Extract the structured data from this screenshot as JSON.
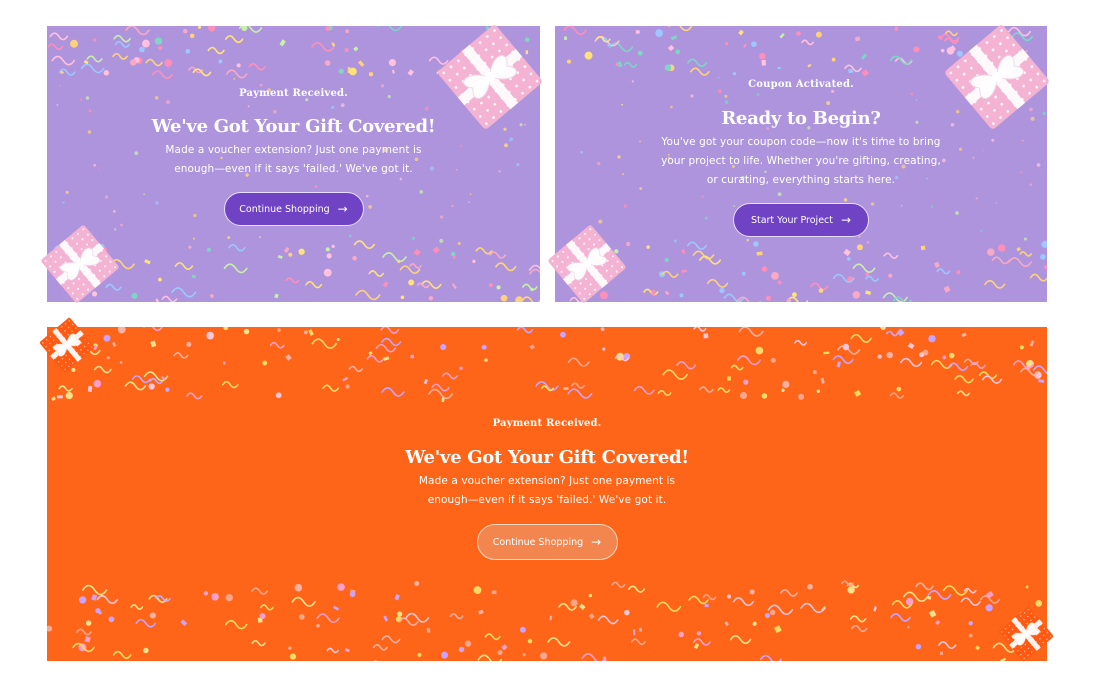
{
  "colors": {
    "purple_bg": "#ad94dd",
    "purple_button": "#7043c4",
    "orange_bg": "#fe6519",
    "orange_button": "#f2864e",
    "gift_pink": "#f4b3d3",
    "gift_orange": "#ff5a14"
  },
  "cards": [
    {
      "eyebrow": "Payment Received.",
      "title": "We've Got Your Gift Covered!",
      "body_lines": [
        "Made a voucher extension? Just one payment is",
        "enough—even if it says 'failed.' We've got it."
      ],
      "button_label": "Continue Shopping",
      "button_icon": "arrow-right-icon"
    },
    {
      "eyebrow": "Coupon Activated.",
      "title": "Ready to Begin?",
      "body_lines": [
        "You've got your coupon code—now it's time to bring",
        "your project to life. Whether you're gifting, creating,",
        "or curating, everything starts here."
      ],
      "button_label": "Start Your Project",
      "button_icon": "arrow-right-icon"
    },
    {
      "eyebrow": "Payment Received.",
      "title": "We've Got Your Gift Covered!",
      "body_lines": [
        "Made a voucher extension? Just one payment is",
        "enough—even if it says 'failed.' We've got it."
      ],
      "button_label": "Continue Shopping",
      "button_icon": "arrow-right-icon"
    }
  ]
}
